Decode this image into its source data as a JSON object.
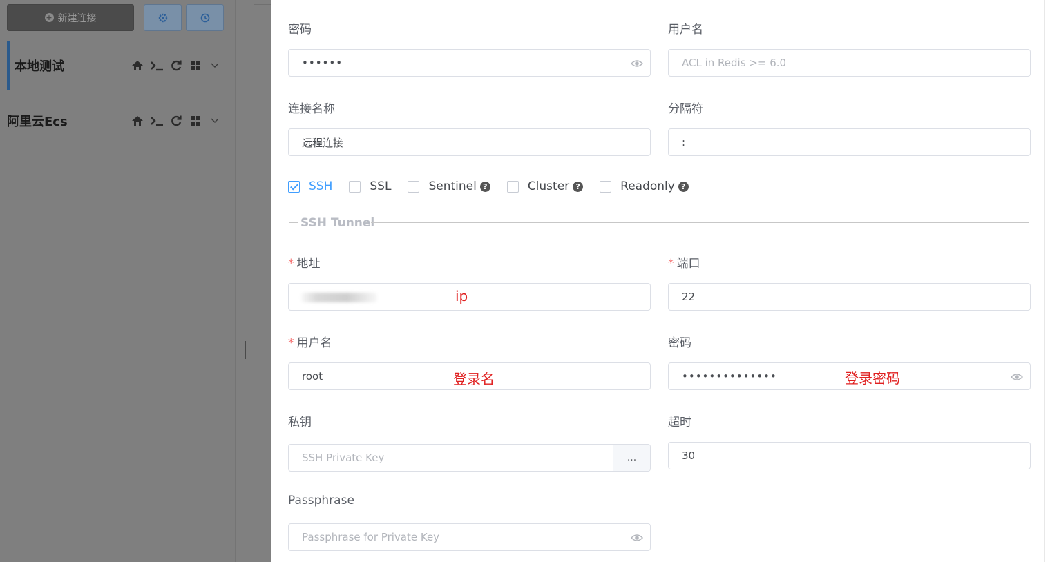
{
  "sidebar": {
    "new_connection_label": "新建连接",
    "settings_icon": "gear-icon",
    "history_icon": "clock-icon",
    "connections": [
      {
        "name": "本地测试",
        "active": true
      },
      {
        "name": "阿里云Ecs",
        "active": false
      }
    ],
    "tool_icons": [
      "home-icon",
      "terminal-icon",
      "refresh-icon",
      "grid-icon",
      "chevron-down-icon"
    ]
  },
  "form": {
    "password": {
      "label": "密码",
      "value": "••••••"
    },
    "acl_username": {
      "label": "用户名",
      "placeholder": "ACL in Redis >= 6.0"
    },
    "connection_name": {
      "label": "连接名称",
      "value": "远程连接"
    },
    "separator": {
      "label": "分隔符",
      "value": ":"
    },
    "options": [
      {
        "label": "SSH",
        "checked": true,
        "help": false
      },
      {
        "label": "SSL",
        "checked": false,
        "help": false
      },
      {
        "label": "Sentinel",
        "checked": false,
        "help": true
      },
      {
        "label": "Cluster",
        "checked": false,
        "help": true
      },
      {
        "label": "Readonly",
        "checked": false,
        "help": true
      }
    ],
    "help_glyph": "?"
  },
  "ssh_tunnel": {
    "legend": "SSH Tunnel",
    "host": {
      "label": "地址",
      "required": "*",
      "annotation": "ip"
    },
    "port": {
      "label": "端口",
      "required": "*",
      "value": "22"
    },
    "username": {
      "label": "用户名",
      "required": "*",
      "value": "root",
      "annotation": "登录名"
    },
    "password": {
      "label": "密码",
      "value": "••••••••••••••",
      "annotation": "登录密码"
    },
    "private_key": {
      "label": "私钥",
      "placeholder": "SSH Private Key",
      "button": "..."
    },
    "timeout": {
      "label": "超时",
      "value": "30"
    },
    "passphrase": {
      "label": "Passphrase",
      "placeholder": "Passphrase for Private Key"
    }
  },
  "colors": {
    "accent": "#409eff",
    "required": "#f56c6c",
    "annotation": "#e02020",
    "overlay_gray": "#7f7f7f"
  }
}
